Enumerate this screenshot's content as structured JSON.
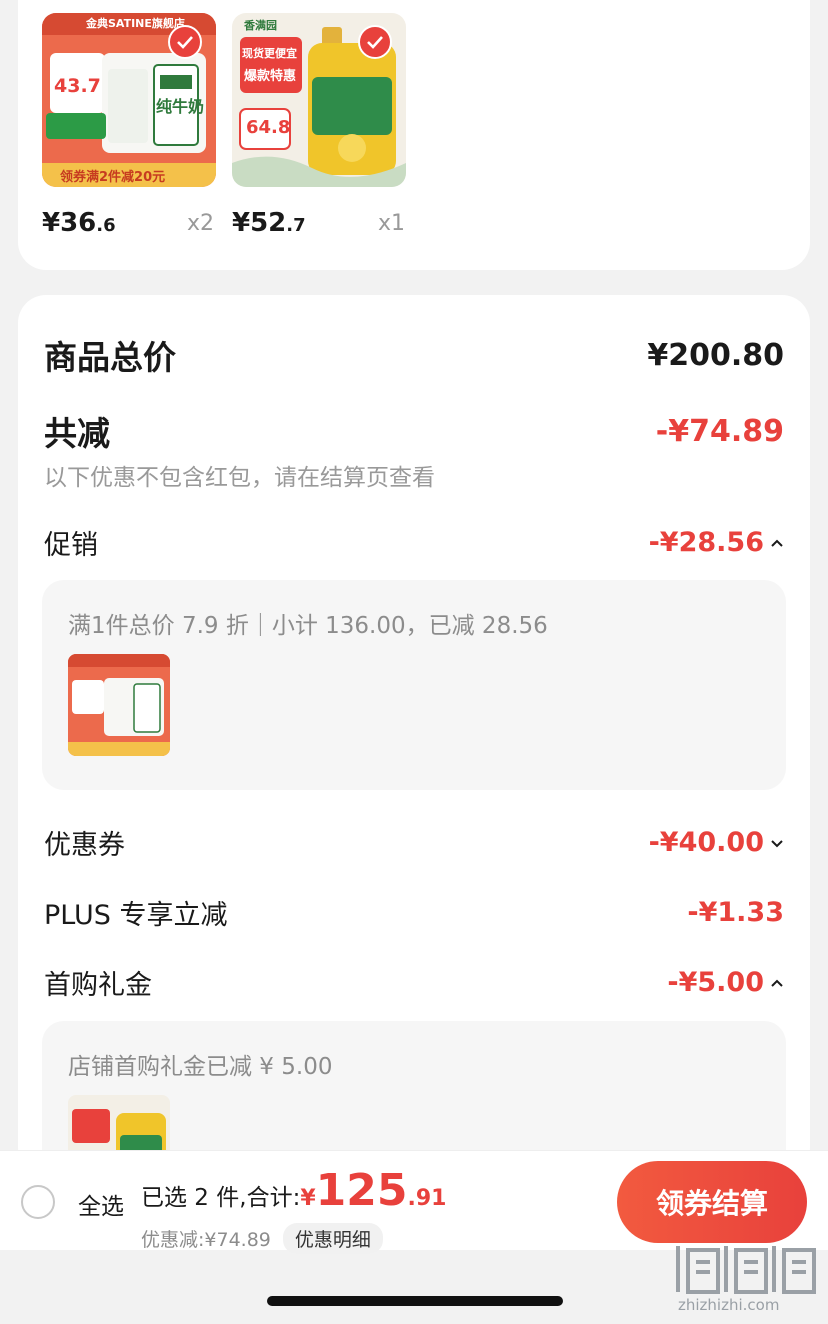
{
  "products": [
    {
      "price_int": "¥36",
      "price_dec": ".6",
      "qty": "x2",
      "image": "milk-box-product",
      "brand_text": "金典SATINE旗舰店",
      "promo_price": "43.7",
      "coupon_text": "领券满2件减20元",
      "product_text": "纯牛奶",
      "checked": true
    },
    {
      "price_int": "¥52",
      "price_dec": ".7",
      "qty": "x1",
      "image": "cooking-oil-product",
      "brand_text": "香满园",
      "promo_price": "64.8",
      "banner_line1": "现货更便宜",
      "banner_line2": "爆款特惠",
      "checked": true
    }
  ],
  "summary": {
    "total_label": "商品总价",
    "total_value": "¥200.80",
    "reduce_label": "共减",
    "reduce_value": "-¥74.89",
    "note": "以下优惠不包含红包，请在结算页查看",
    "promo_label": "促销",
    "promo_value": "-¥28.56",
    "promo_detail": "满1件总价 7.9 折｜小计 136.00，已减 28.56",
    "coupon_label": "优惠券",
    "coupon_value": "-¥40.00",
    "plus_label": "PLUS 专享立减",
    "plus_value": "-¥1.33",
    "firstbuy_label": "首购礼金",
    "firstbuy_value": "-¥5.00",
    "firstbuy_detail": "店铺首购礼金已减 ¥ 5.00"
  },
  "bottom_bar": {
    "select_all": "全选",
    "selected_text": "已选 2 件,合计:",
    "currency": "¥",
    "total_int": "125",
    "total_dec": ".91",
    "saved_text": "优惠减:¥74.89",
    "detail_button": "优惠明细",
    "checkout_button": "领券结算"
  },
  "watermark": {
    "sub": "zhizhizhi.com"
  },
  "colors": {
    "accent": "#e8413c",
    "muted": "#999999"
  }
}
